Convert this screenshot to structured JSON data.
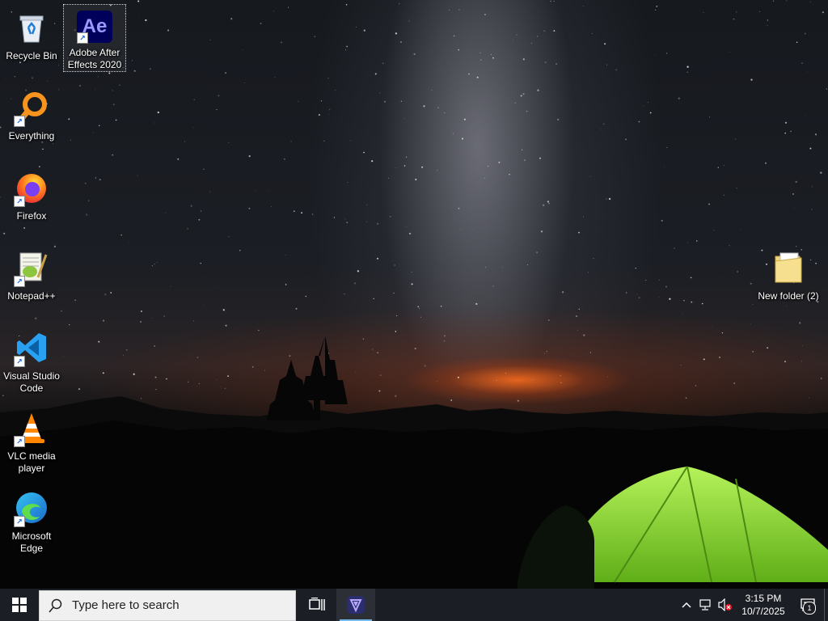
{
  "desktop": {
    "icons": [
      {
        "label": "Recycle Bin",
        "icon": "recycle-bin-icon"
      },
      {
        "label": "Adobe After Effects 2020",
        "icon": "after-effects-icon",
        "app_abbrev": "Ae"
      },
      {
        "label": "Everything",
        "icon": "everything-search-icon"
      },
      {
        "label": "Firefox",
        "icon": "firefox-icon"
      },
      {
        "label": "Notepad++",
        "icon": "notepadpp-icon"
      },
      {
        "label": "Visual Studio Code",
        "icon": "vscode-icon"
      },
      {
        "label": "VLC media player",
        "icon": "vlc-icon"
      },
      {
        "label": "Microsoft Edge",
        "icon": "edge-icon"
      },
      {
        "label": "New folder (2)",
        "icon": "folder-icon"
      }
    ],
    "shortcut_arrow": "↗"
  },
  "taskbar": {
    "search_placeholder": "Type here to search",
    "pinned": [
      {
        "icon": "task-view-icon"
      },
      {
        "icon": "pinned-app-icon"
      }
    ],
    "clock": {
      "time": "3:15 PM",
      "date": "10/7/2025"
    },
    "notification_count": "1",
    "colors": {
      "taskbar": "#1c1e26",
      "accent": "#76b9ed"
    }
  }
}
